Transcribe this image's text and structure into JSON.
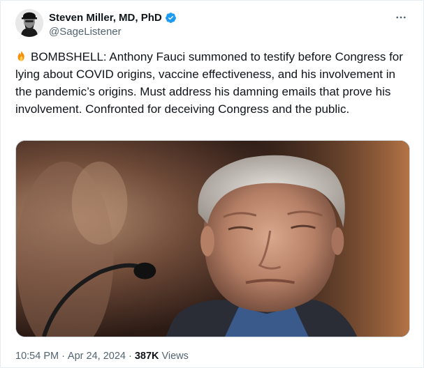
{
  "author": {
    "display_name": "Steven Miller, MD, PhD",
    "handle": "@SageListener",
    "verified": true,
    "avatar_icon": "avatar-portrait-icon"
  },
  "more_icon": "more-options-icon",
  "tweet": {
    "emoji_icon": "fire-emoji-icon",
    "text": "BOMBSHELL: Anthony Fauci summoned to testify before Congress for lying about COVID origins, vaccine effectiveness, and his involvement in the pandemic’s origins. Must address his damning emails that prove his involvement. Confronted for deceiving Congress and the public."
  },
  "media": {
    "type": "photo"
  },
  "meta": {
    "time": "10:54 PM",
    "separator": "·",
    "date": "Apr 24, 2024",
    "views_count": "387K",
    "views_label": "Views"
  },
  "colors": {
    "text": "#0f1419",
    "secondary": "#536471",
    "verified_blue": "#1d9bf0",
    "border": "#cfd9de"
  }
}
